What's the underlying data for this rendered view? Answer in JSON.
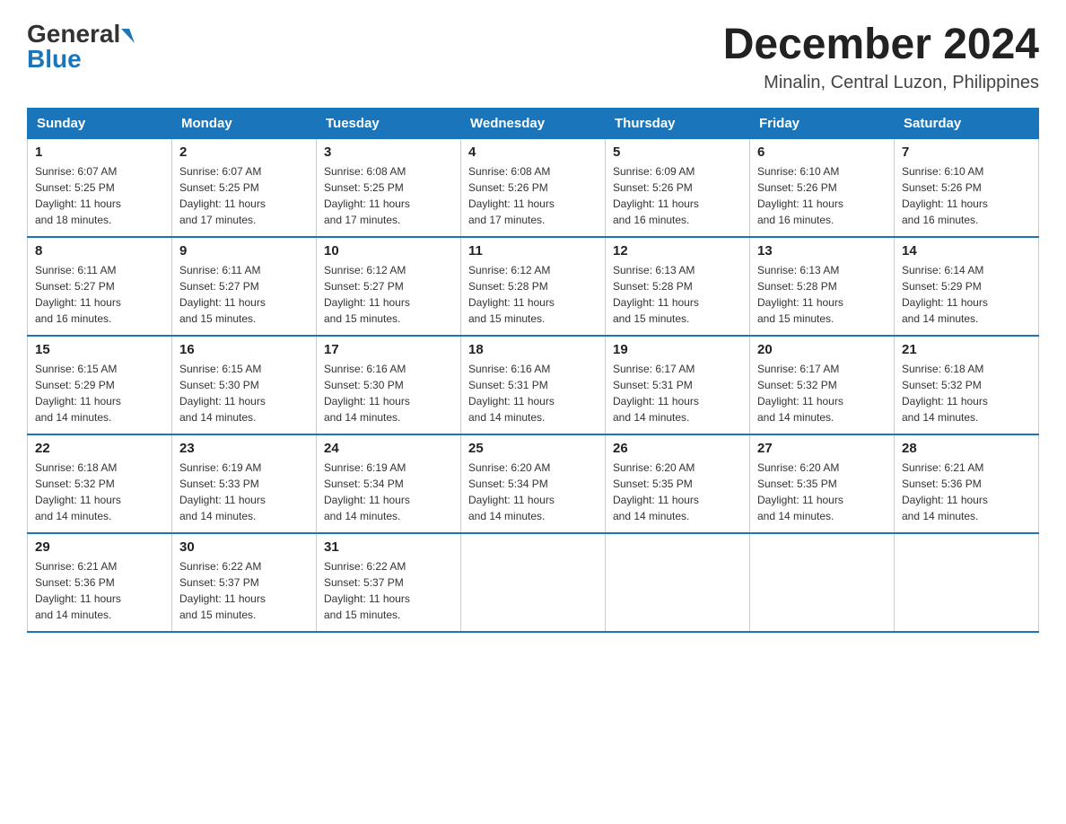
{
  "header": {
    "logo_general": "General",
    "logo_blue": "Blue",
    "month_year": "December 2024",
    "location": "Minalin, Central Luzon, Philippines"
  },
  "days_of_week": [
    "Sunday",
    "Monday",
    "Tuesday",
    "Wednesday",
    "Thursday",
    "Friday",
    "Saturday"
  ],
  "weeks": [
    [
      {
        "day": "1",
        "sunrise": "6:07 AM",
        "sunset": "5:25 PM",
        "daylight": "11 hours and 18 minutes."
      },
      {
        "day": "2",
        "sunrise": "6:07 AM",
        "sunset": "5:25 PM",
        "daylight": "11 hours and 17 minutes."
      },
      {
        "day": "3",
        "sunrise": "6:08 AM",
        "sunset": "5:25 PM",
        "daylight": "11 hours and 17 minutes."
      },
      {
        "day": "4",
        "sunrise": "6:08 AM",
        "sunset": "5:26 PM",
        "daylight": "11 hours and 17 minutes."
      },
      {
        "day": "5",
        "sunrise": "6:09 AM",
        "sunset": "5:26 PM",
        "daylight": "11 hours and 16 minutes."
      },
      {
        "day": "6",
        "sunrise": "6:10 AM",
        "sunset": "5:26 PM",
        "daylight": "11 hours and 16 minutes."
      },
      {
        "day": "7",
        "sunrise": "6:10 AM",
        "sunset": "5:26 PM",
        "daylight": "11 hours and 16 minutes."
      }
    ],
    [
      {
        "day": "8",
        "sunrise": "6:11 AM",
        "sunset": "5:27 PM",
        "daylight": "11 hours and 16 minutes."
      },
      {
        "day": "9",
        "sunrise": "6:11 AM",
        "sunset": "5:27 PM",
        "daylight": "11 hours and 15 minutes."
      },
      {
        "day": "10",
        "sunrise": "6:12 AM",
        "sunset": "5:27 PM",
        "daylight": "11 hours and 15 minutes."
      },
      {
        "day": "11",
        "sunrise": "6:12 AM",
        "sunset": "5:28 PM",
        "daylight": "11 hours and 15 minutes."
      },
      {
        "day": "12",
        "sunrise": "6:13 AM",
        "sunset": "5:28 PM",
        "daylight": "11 hours and 15 minutes."
      },
      {
        "day": "13",
        "sunrise": "6:13 AM",
        "sunset": "5:28 PM",
        "daylight": "11 hours and 15 minutes."
      },
      {
        "day": "14",
        "sunrise": "6:14 AM",
        "sunset": "5:29 PM",
        "daylight": "11 hours and 14 minutes."
      }
    ],
    [
      {
        "day": "15",
        "sunrise": "6:15 AM",
        "sunset": "5:29 PM",
        "daylight": "11 hours and 14 minutes."
      },
      {
        "day": "16",
        "sunrise": "6:15 AM",
        "sunset": "5:30 PM",
        "daylight": "11 hours and 14 minutes."
      },
      {
        "day": "17",
        "sunrise": "6:16 AM",
        "sunset": "5:30 PM",
        "daylight": "11 hours and 14 minutes."
      },
      {
        "day": "18",
        "sunrise": "6:16 AM",
        "sunset": "5:31 PM",
        "daylight": "11 hours and 14 minutes."
      },
      {
        "day": "19",
        "sunrise": "6:17 AM",
        "sunset": "5:31 PM",
        "daylight": "11 hours and 14 minutes."
      },
      {
        "day": "20",
        "sunrise": "6:17 AM",
        "sunset": "5:32 PM",
        "daylight": "11 hours and 14 minutes."
      },
      {
        "day": "21",
        "sunrise": "6:18 AM",
        "sunset": "5:32 PM",
        "daylight": "11 hours and 14 minutes."
      }
    ],
    [
      {
        "day": "22",
        "sunrise": "6:18 AM",
        "sunset": "5:32 PM",
        "daylight": "11 hours and 14 minutes."
      },
      {
        "day": "23",
        "sunrise": "6:19 AM",
        "sunset": "5:33 PM",
        "daylight": "11 hours and 14 minutes."
      },
      {
        "day": "24",
        "sunrise": "6:19 AM",
        "sunset": "5:34 PM",
        "daylight": "11 hours and 14 minutes."
      },
      {
        "day": "25",
        "sunrise": "6:20 AM",
        "sunset": "5:34 PM",
        "daylight": "11 hours and 14 minutes."
      },
      {
        "day": "26",
        "sunrise": "6:20 AM",
        "sunset": "5:35 PM",
        "daylight": "11 hours and 14 minutes."
      },
      {
        "day": "27",
        "sunrise": "6:20 AM",
        "sunset": "5:35 PM",
        "daylight": "11 hours and 14 minutes."
      },
      {
        "day": "28",
        "sunrise": "6:21 AM",
        "sunset": "5:36 PM",
        "daylight": "11 hours and 14 minutes."
      }
    ],
    [
      {
        "day": "29",
        "sunrise": "6:21 AM",
        "sunset": "5:36 PM",
        "daylight": "11 hours and 14 minutes."
      },
      {
        "day": "30",
        "sunrise": "6:22 AM",
        "sunset": "5:37 PM",
        "daylight": "11 hours and 15 minutes."
      },
      {
        "day": "31",
        "sunrise": "6:22 AM",
        "sunset": "5:37 PM",
        "daylight": "11 hours and 15 minutes."
      },
      null,
      null,
      null,
      null
    ]
  ],
  "labels": {
    "sunrise": "Sunrise:",
    "sunset": "Sunset:",
    "daylight": "Daylight:"
  }
}
